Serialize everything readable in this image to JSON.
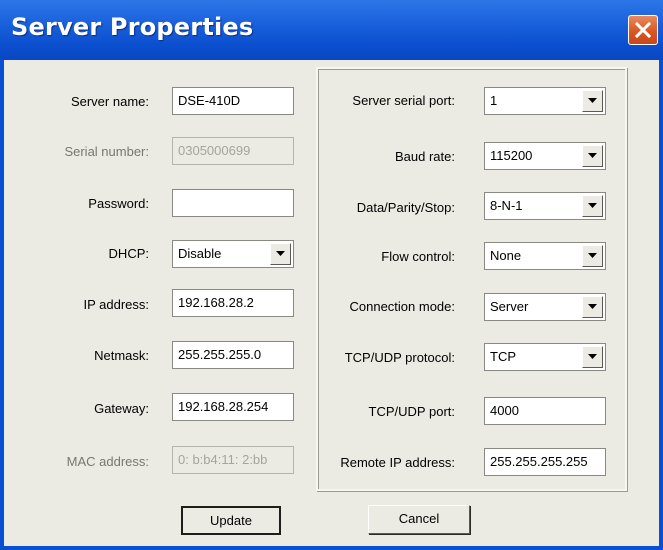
{
  "window": {
    "title": "Server Properties",
    "close_icon": "close-icon"
  },
  "left": {
    "server_name": {
      "label": "Server name:",
      "value": "DSE-410D"
    },
    "serial_number": {
      "label": "Serial number:",
      "value": "0305000699"
    },
    "password": {
      "label": "Password:",
      "value": ""
    },
    "dhcp": {
      "label": "DHCP:",
      "value": "Disable"
    },
    "ip_address": {
      "label": "IP address:",
      "value": "192.168.28.2"
    },
    "netmask": {
      "label": "Netmask:",
      "value": "255.255.255.0"
    },
    "gateway": {
      "label": "Gateway:",
      "value": "192.168.28.254"
    },
    "mac_address": {
      "label": "MAC address:",
      "value": "0: b:b4:11: 2:bb"
    }
  },
  "right": {
    "serial_port": {
      "label": "Server serial port:",
      "value": "1"
    },
    "baud_rate": {
      "label": "Baud rate:",
      "value": "115200"
    },
    "data_parity_stop": {
      "label": "Data/Parity/Stop:",
      "value": "8-N-1"
    },
    "flow_control": {
      "label": "Flow control:",
      "value": "None"
    },
    "connection_mode": {
      "label": "Connection mode:",
      "value": "Server"
    },
    "protocol": {
      "label": "TCP/UDP protocol:",
      "value": "TCP"
    },
    "port": {
      "label": "TCP/UDP port:",
      "value": "4000"
    },
    "remote_ip": {
      "label": "Remote IP address:",
      "value": "255.255.255.255"
    }
  },
  "buttons": {
    "update": "Update",
    "cancel": "Cancel"
  },
  "colors": {
    "titlebar": "#0b4fcf",
    "close": "#d85724",
    "dialog_bg": "#ecebe3"
  }
}
